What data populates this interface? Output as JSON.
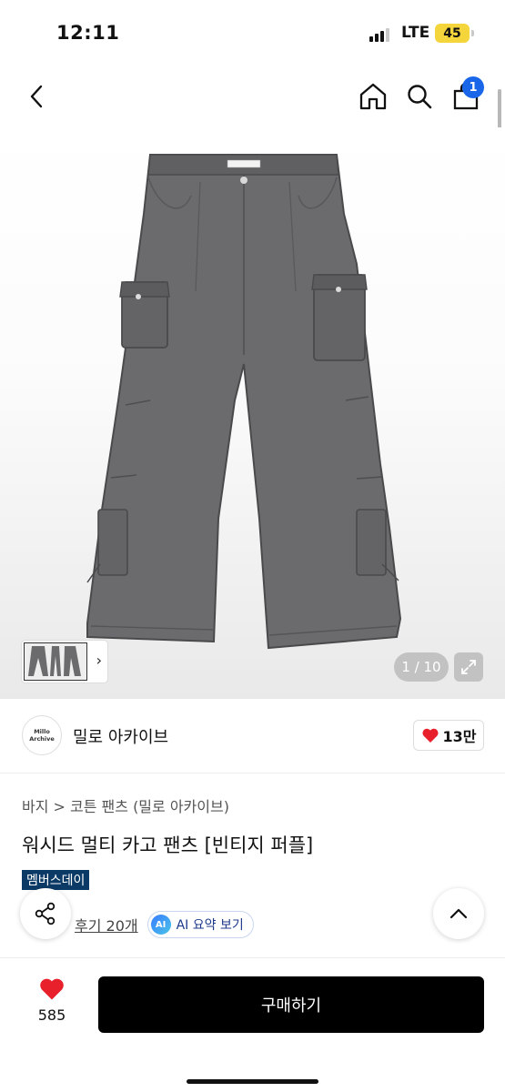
{
  "status_bar": {
    "time": "12:11",
    "network": "LTE",
    "battery": "45"
  },
  "nav": {
    "cart_count": "1",
    "icons": [
      "back-icon",
      "home-icon",
      "search-icon",
      "shopping-bag-icon"
    ]
  },
  "gallery": {
    "counter": "1 / 10",
    "thumbnail_arrow": "›"
  },
  "brand": {
    "logo_text": "Millo Archive",
    "name": "밀로 아카이브",
    "likes": "13만"
  },
  "product": {
    "breadcrumb": "바지 > 코튼 팬츠 (밀로 아카이브)",
    "title": "워시드 멀티 카고 팬츠 [빈티지 퍼플]",
    "tag": "멤버스데이",
    "review_link": "후기 20개",
    "ai_badge": "AI",
    "ai_summary_label": "AI 요약 보기"
  },
  "bottom": {
    "heart_count": "585",
    "buy_label": "구매하기"
  },
  "colors": {
    "accent_blue": "#1a66e8",
    "heart_red": "#e8202b",
    "tag_navy": "#0b3a66",
    "pants_gray": "#6b6b6d"
  }
}
